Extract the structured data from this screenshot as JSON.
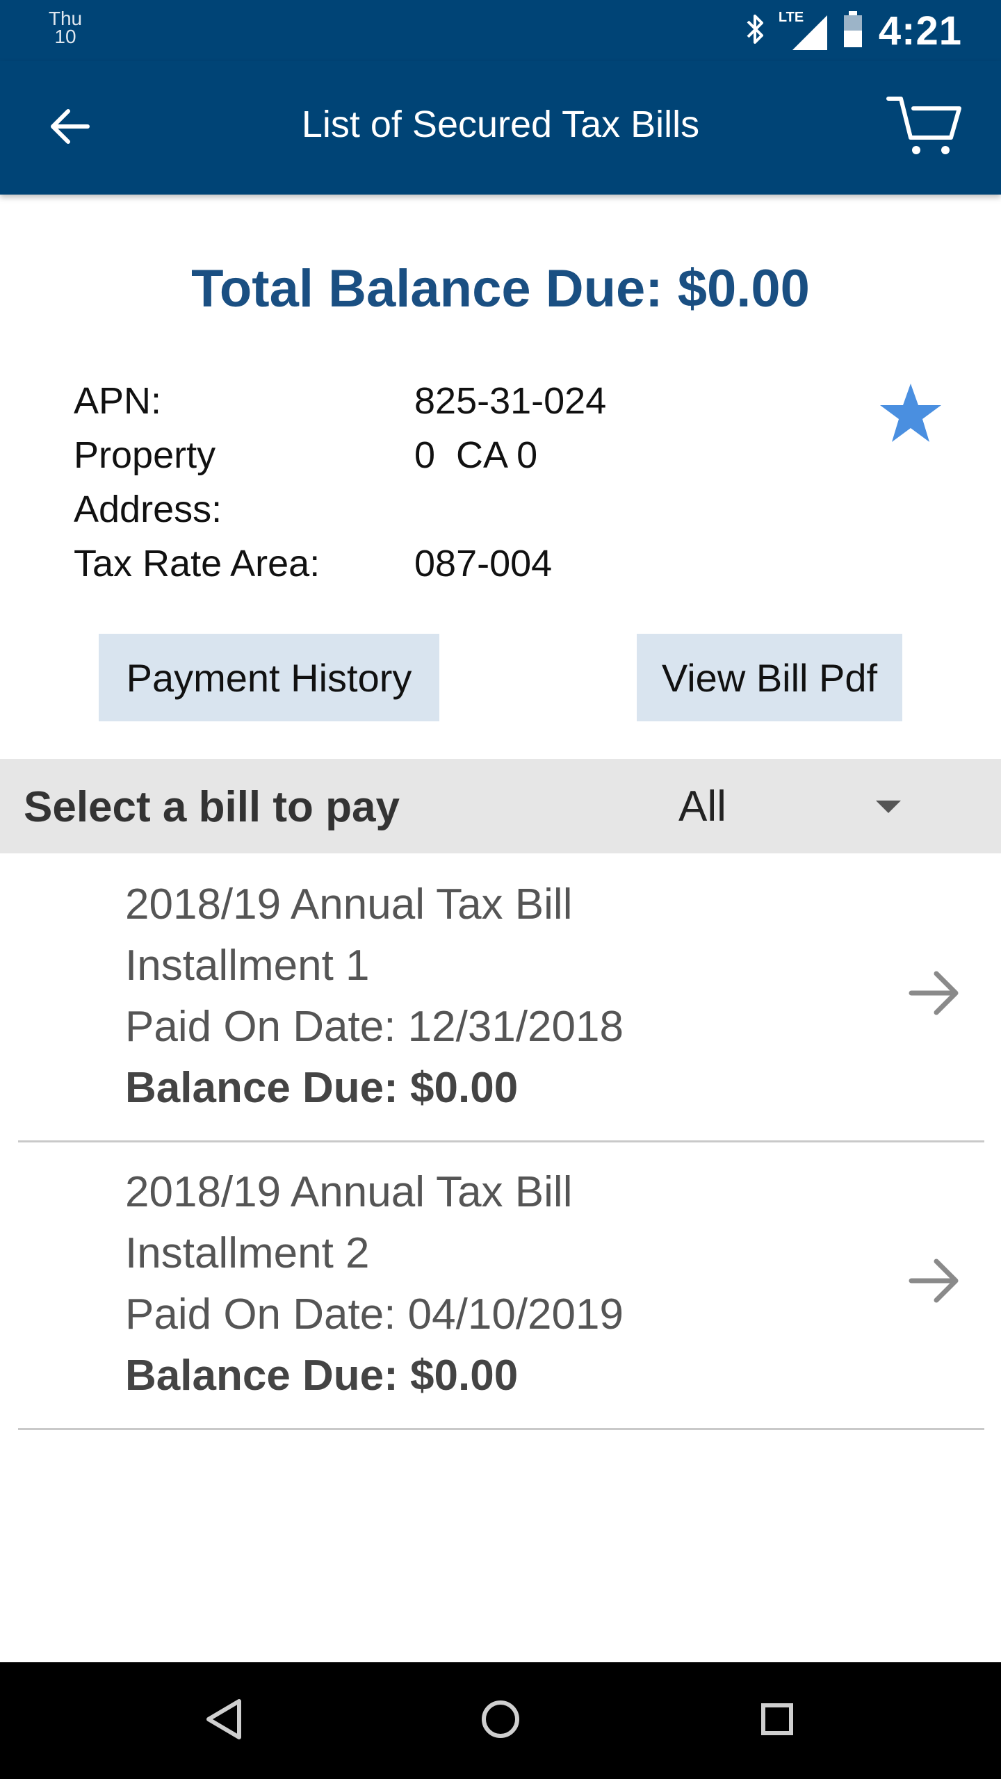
{
  "status_bar": {
    "day": "Thu",
    "date": "10",
    "network": "LTE",
    "time": "4:21"
  },
  "app_bar": {
    "title": "List of Secured Tax Bills"
  },
  "summary": {
    "total_balance": "Total Balance Due: $0.00"
  },
  "property": {
    "apn_label": "APN:",
    "apn_value": "825-31-024",
    "address_label_line1": "Property",
    "address_label_line2": "Address:",
    "address_value": "0  CA 0",
    "tax_rate_label": "Tax Rate Area:",
    "tax_rate_value": "087-004",
    "favorited": true
  },
  "actions": {
    "payment_history": "Payment History",
    "view_bill_pdf": "View Bill Pdf"
  },
  "filter": {
    "label": "Select a bill to pay",
    "selected": "All"
  },
  "bills": [
    {
      "title": "2018/19 Annual Tax Bill",
      "installment": "Installment 1",
      "paid_on": "Paid On Date: 12/31/2018",
      "balance": "Balance Due: $0.00"
    },
    {
      "title": "2018/19 Annual Tax Bill",
      "installment": "Installment 2",
      "paid_on": "Paid On Date: 04/10/2019",
      "balance": "Balance Due: $0.00"
    }
  ],
  "icons": {
    "back": "arrow-left-icon",
    "cart": "cart-icon",
    "favorite": "star-icon",
    "row_arrow": "arrow-right-icon"
  },
  "colors": {
    "header_bg": "#004476",
    "accent_text": "#1a4f82",
    "star": "#4a8fe0",
    "button_bg": "#d9e4ef",
    "filter_bg": "#e6e6e6"
  }
}
